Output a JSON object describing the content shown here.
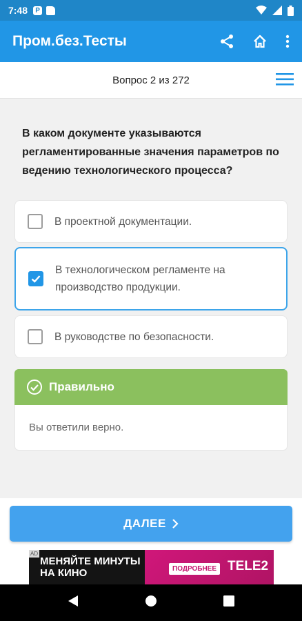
{
  "status_bar": {
    "time": "7:48"
  },
  "app_bar": {
    "title": "Пром.без.Тесты"
  },
  "subheader": {
    "counter": "Вопрос 2 из 272"
  },
  "question": {
    "text": "В каком документе указываются регламентированные значения параметров по ведению технологического процесса?"
  },
  "answers": [
    {
      "text": "В проектной документации.",
      "checked": false
    },
    {
      "text": "В технологическом регламенте на производство продукции.",
      "checked": true
    },
    {
      "text": "В руководстве по безопасности.",
      "checked": false
    }
  ],
  "result": {
    "title": "Правильно",
    "message": "Вы ответили верно.",
    "color": "#8bc05e"
  },
  "next_button": {
    "label": "ДАЛЕЕ"
  },
  "ad": {
    "text": "МЕНЯЙТЕ МИНУТЫ НА КИНО",
    "button": "ПОДРОБНЕЕ",
    "brand": "TELE2",
    "tag": "AD"
  },
  "colors": {
    "primary": "#2196e6",
    "status_bar": "#1f86c8",
    "correct": "#8bc05e"
  }
}
